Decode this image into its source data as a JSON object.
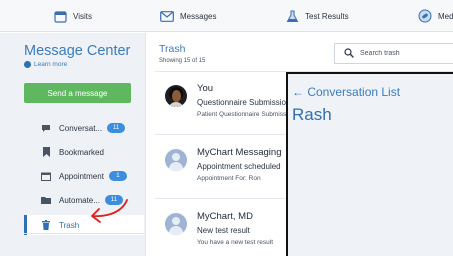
{
  "topnav": {
    "items": [
      {
        "label": "Visits",
        "icon": "calendar-icon"
      },
      {
        "label": "Messages",
        "icon": "envelope-icon"
      },
      {
        "label": "Test Results",
        "icon": "flask-icon"
      },
      {
        "label": "Medi",
        "icon": "medications-icon"
      }
    ]
  },
  "sidebar": {
    "title": "Message Center",
    "learn_more": "Learn more",
    "send_button": "Send a message",
    "items": [
      {
        "label": "Conversat...",
        "badge": "11",
        "icon": "chat-bubble-icon"
      },
      {
        "label": "Bookmarked",
        "badge": "",
        "icon": "bookmark-icon"
      },
      {
        "label": "Appointment",
        "badge": "1",
        "icon": "calendar-icon"
      },
      {
        "label": "Automate...",
        "badge": "11",
        "icon": "folder-icon"
      },
      {
        "label": "Trash",
        "badge": "",
        "icon": "trash-icon"
      }
    ]
  },
  "list": {
    "title": "Trash",
    "subtitle": "Showing 15 of 15",
    "search_placeholder": "Search trash",
    "messages": [
      {
        "from": "You",
        "subject": "Questionnaire Submission",
        "preview": "Patient Questionnaire Submission",
        "avatar": "photo"
      },
      {
        "from": "MyChart Messaging",
        "subject": "Appointment scheduled",
        "preview": "Appointment For: Ron",
        "avatar": "generic"
      },
      {
        "from": "MyChart, MD",
        "subject": "New test result",
        "preview": "You have a new test result",
        "avatar": "generic"
      }
    ]
  },
  "detail": {
    "back_label": "← Conversation List",
    "title": "Rash"
  },
  "annotation": {
    "color": "#e11d1d"
  },
  "colors": {
    "accent": "#3c7bbd",
    "send": "#5fb75f",
    "badge": "#3d8ddd"
  }
}
